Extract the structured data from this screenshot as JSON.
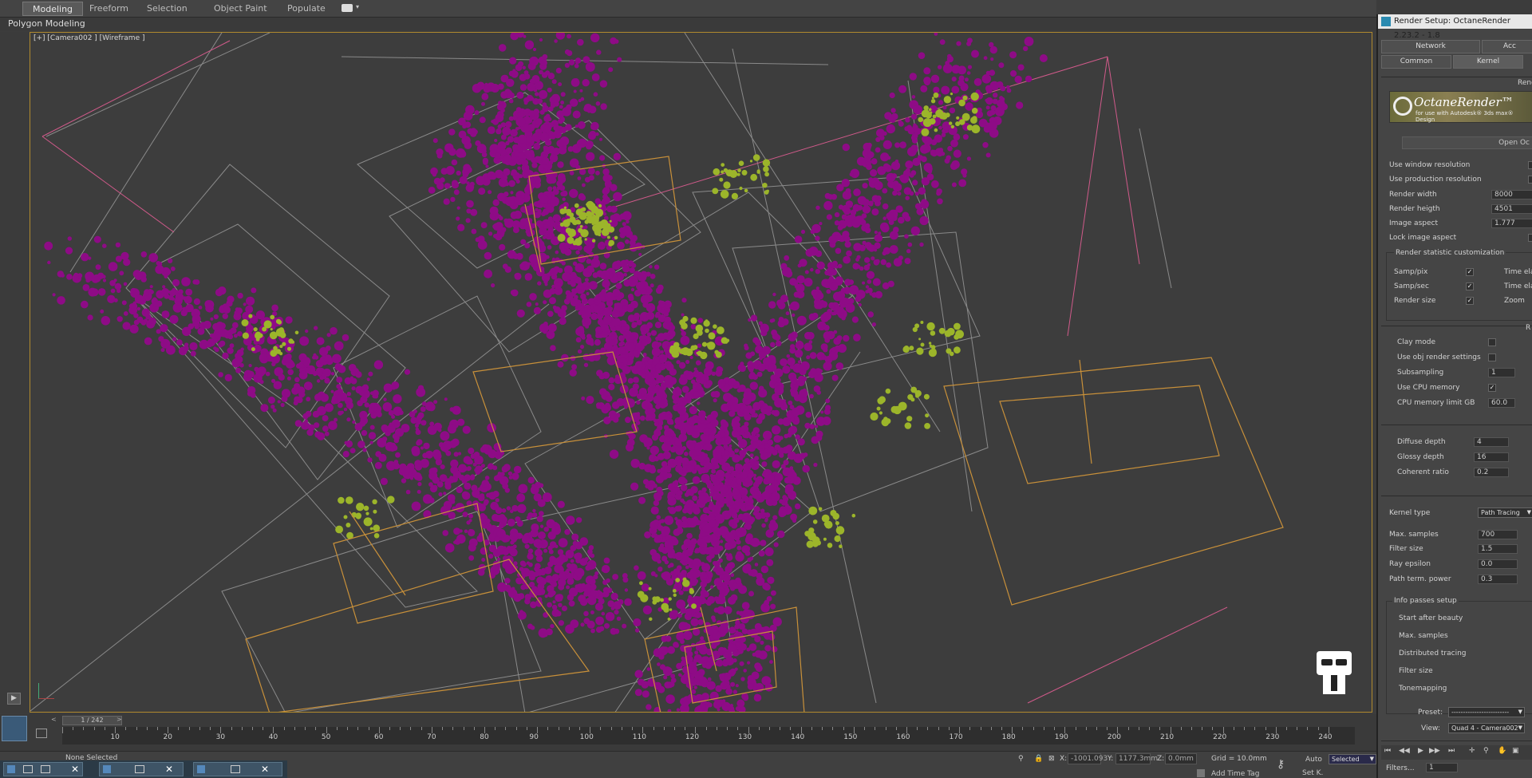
{
  "ribbon": {
    "tabs": [
      "Modeling",
      "Freeform",
      "Selection",
      "Object Paint",
      "Populate"
    ],
    "active_tab": "Modeling",
    "sub_label": "Polygon Modeling"
  },
  "viewport": {
    "label": "[+] [Camera002 ] [Wireframe ]"
  },
  "timeline": {
    "frame_display": "1 / 242",
    "ticks": [
      "10",
      "20",
      "30",
      "40",
      "50",
      "60",
      "70",
      "80",
      "90",
      "100",
      "110",
      "120",
      "130",
      "140",
      "150",
      "160",
      "170",
      "180",
      "190",
      "200",
      "210",
      "220",
      "230",
      "240"
    ]
  },
  "status": {
    "selection_text": "None Selected",
    "x_label": "X:",
    "x_value": "-1001.093",
    "y_label": "Y:",
    "y_value": "1177.3mm",
    "z_label": "Z:",
    "z_value": "0.0mm",
    "grid_text": "Grid = 10.0mm",
    "add_time_tag": "Add Time Tag",
    "auto_label": "Auto",
    "set_key_label": "Set K.",
    "selected_dropdown": "Selected",
    "filters_label": "Filters..."
  },
  "render_panel": {
    "title": "Render Setup: OctaneRender 2.23.2 - 1.8",
    "tabs_row1": [
      "Network",
      "Acc"
    ],
    "tabs_row2": [
      "Common",
      "Kernel"
    ],
    "active_tab": "Kernel",
    "section_header": "Rend",
    "logo_title": "OctaneRender™",
    "logo_sub": "for use with Autodesk® 3ds max® Design",
    "open_button": "Open Oc",
    "rows_resolution": [
      {
        "label": "Use window resolution"
      },
      {
        "label": "Use production resolution"
      }
    ],
    "render_width_label": "Render width",
    "render_width": "8000",
    "render_height_label": "Render heigth",
    "render_height": "4501",
    "image_aspect_label": "Image aspect",
    "image_aspect": "1.777",
    "lock_aspect_label": "Lock image aspect",
    "stat_group_label": "Render statistic customization",
    "stats": [
      {
        "label": "Samp/pix",
        "right": "Time elaps"
      },
      {
        "label": "Samp/sec",
        "right": "Time elaps"
      },
      {
        "label": "Render size",
        "right": "Zoom"
      }
    ],
    "r_header": "R",
    "clay_mode": "Clay mode",
    "use_obj": "Use obj render settings",
    "subsampling": "Subsampling",
    "subsampling_val": "1",
    "use_cpu": "Use CPU memory",
    "cpu_limit": "CPU memory limit GB",
    "cpu_limit_val": "60.0",
    "diffuse_depth": "Diffuse depth",
    "diffuse_depth_val": "4",
    "glossy_depth": "Glossy depth",
    "glossy_depth_val": "16",
    "coherent_ratio": "Coherent ratio",
    "coherent_ratio_val": "0.2",
    "kernel_type": "Kernel type",
    "kernel_type_val": "Path Tracing",
    "max_samples": "Max. samples",
    "max_samples_val": "700",
    "filter_size": "Filter size",
    "filter_size_val": "1.5",
    "ray_epsilon": "Ray epsilon",
    "ray_epsilon_val": "0.0",
    "path_term": "Path term. power",
    "path_term_val": "0.3",
    "info_group": "Info passes setup",
    "info_items": [
      "Start after beauty",
      "Max. samples",
      "Distributed tracing",
      "Filter size",
      "Tonemapping"
    ],
    "preset_label": "Preset:",
    "preset_val": "-------------------------",
    "view_label": "View:",
    "view_val": "Quad 4 - Camera002"
  },
  "colors": {
    "particle_magenta": "#8e0b86",
    "particle_green": "#9cb52a",
    "camera_orange": "#c8903a",
    "wire_grey": "#8a8a8a",
    "wire_pink": "#d05a8a"
  }
}
